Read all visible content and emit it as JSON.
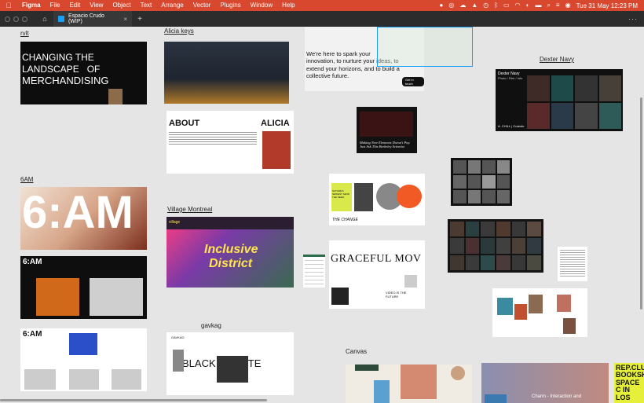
{
  "menubar": {
    "app": "Figma",
    "items": [
      "File",
      "Edit",
      "View",
      "Object",
      "Text",
      "Arrange",
      "Vector",
      "Plugins",
      "Window",
      "Help"
    ],
    "clock": "Tue 31 May  12:23 PM"
  },
  "tabbar": {
    "file_name": "Espacio Crudo (WIP)",
    "close": "×",
    "add": "+",
    "more": "···"
  },
  "frames": {
    "rvlt": {
      "label": "rvlt",
      "headline_1": "CHANGING THE",
      "headline_2": "LANDSCAPE   OF",
      "headline_3": "MERCHANDISING"
    },
    "alicia": {
      "label": "Alicia keys",
      "about": "ABOUT",
      "name": "ALICIA"
    },
    "spark": {
      "text": "We're here to spark your innovation, to nurture your ideas, to extend your horizons, and to build a collective future.",
      "button": "Get in touch"
    },
    "berkeley": {
      "caption": "Making New Elements Doesn't Pay. Just Ask This Berkeley Scientist"
    },
    "dexter": {
      "label": "Dexter Navy",
      "title": "Dexter Navy",
      "subtitle": "Photo / Film / Info",
      "footer": "A. CHILL | Cuándo"
    },
    "sixam": {
      "label": "6AM",
      "big": "6:AM",
      "small_1": "6:AM",
      "small_2": "6:AM"
    },
    "change": {
      "headline": "THE CHANGE",
      "text": "NATURE'S NEWEST SEND THE SEED"
    },
    "village": {
      "label": "Village Montreal",
      "logo": "village",
      "headline_1": "Inclusive",
      "headline_2": "District"
    },
    "graceful": {
      "headline": "GRACEFUL MOV",
      "text_1": "VIDEO IS THE FUTURE"
    },
    "gavkag": {
      "label": "gavkag",
      "brand": "GAVKAG",
      "headline": "BLACK & WHITE"
    },
    "canvas": {
      "label": "Canvas"
    },
    "repclub": {
      "text": "REP.CLUB BOOKSH SPACE C IN LOS"
    },
    "darkcard": {
      "text": "Charm - Interaction and"
    }
  }
}
